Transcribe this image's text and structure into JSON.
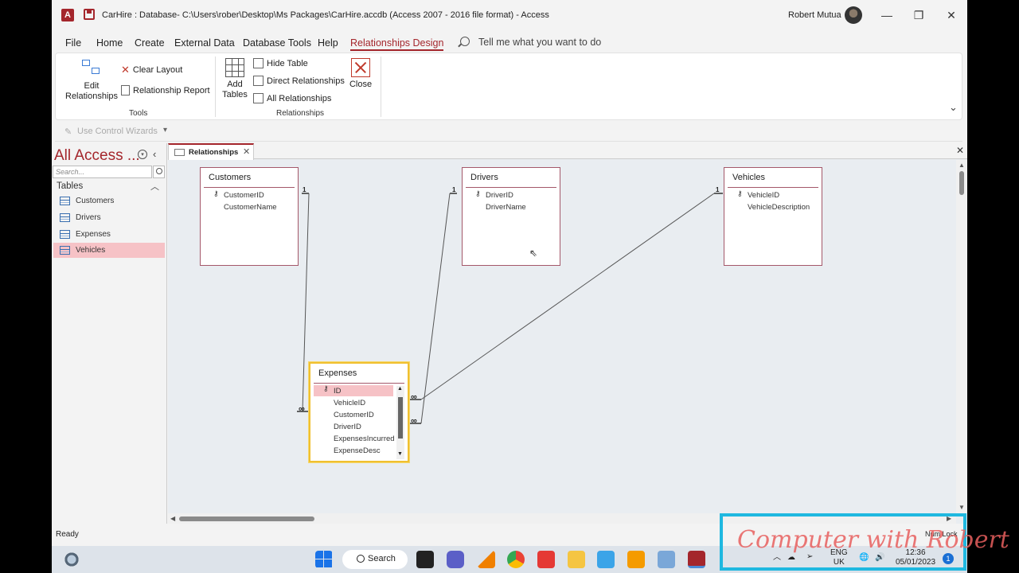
{
  "window": {
    "title": "CarHire : Database- C:\\Users\\rober\\Desktop\\Ms Packages\\CarHire.accdb (Access 2007 - 2016 file format)  -  Access",
    "user": "Robert Mutua",
    "app_icon_letter": "A",
    "minimize": "—",
    "restore": "❐",
    "close": "✕"
  },
  "menu": {
    "items": [
      "File",
      "Home",
      "Create",
      "External Data",
      "Database Tools",
      "Help",
      "Relationships Design"
    ],
    "active_index": 6,
    "tell_me": "Tell me what you want to do"
  },
  "ribbon": {
    "tools": {
      "edit_relationships": "Edit",
      "edit_relationships_2": "Relationships",
      "clear_layout": "Clear Layout",
      "relationship_report": "Relationship Report",
      "group_label": "Tools"
    },
    "relationships": {
      "add_tables": "Add",
      "add_tables_2": "Tables",
      "hide_table": "Hide Table",
      "direct_relationships": "Direct Relationships",
      "all_relationships": "All Relationships",
      "close": "Close",
      "group_label": "Relationships"
    },
    "collapse_icon": "⌄"
  },
  "quick_access": {
    "use_control_wizards": "Use Control Wizards",
    "dropdown": "▾"
  },
  "nav_pane": {
    "title": "All Access ...",
    "search_placeholder": "Search...",
    "group": "Tables",
    "items": [
      "Customers",
      "Drivers",
      "Expenses",
      "Vehicles"
    ],
    "selected_index": 3
  },
  "document": {
    "tab_label": "Relationships",
    "tab_close": "✕",
    "window_close": "✕"
  },
  "tables": {
    "customers": {
      "title": "Customers",
      "fields": [
        "CustomerID",
        "CustomerName"
      ],
      "key": "CustomerID"
    },
    "drivers": {
      "title": "Drivers",
      "fields": [
        "DriverID",
        "DriverName"
      ],
      "key": "DriverID"
    },
    "vehicles": {
      "title": "Vehicles",
      "fields": [
        "VehicleID",
        "VehicleDescription"
      ],
      "key": "VehicleID"
    },
    "expenses": {
      "title": "Expenses",
      "fields": [
        "ID",
        "VehicleID",
        "CustomerID",
        "DriverID",
        "ExpensesIncurred",
        "ExpenseDesc"
      ],
      "key": "ID"
    }
  },
  "relationship_marks": {
    "one": "1",
    "many": "∞"
  },
  "status": {
    "text": "Ready",
    "num_lock": "Num Lock"
  },
  "taskbar": {
    "search": "Search",
    "lang_1": "ENG",
    "lang_2": "UK",
    "time": "12:36",
    "date": "05/01/2023",
    "notifications": "1"
  },
  "watermark": "Computer with Robert",
  "colors": {
    "accent": "#a4262c",
    "selected_table_border": "#f0c030",
    "nav_selected": "#f6c2c6"
  }
}
